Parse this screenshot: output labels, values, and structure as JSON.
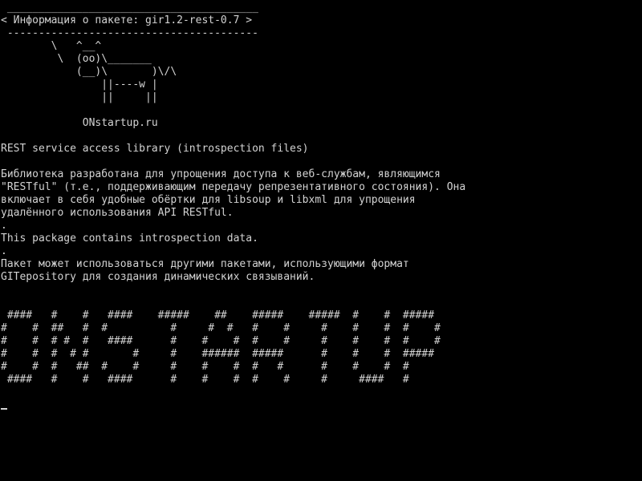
{
  "terminal": {
    "fg_color": "#d3d3d3",
    "bg_color": "#000000",
    "lines": [
      " ________________________________________",
      "< Информация о пакете: gir1.2-rest-0.7 >",
      " ----------------------------------------",
      "        \\   ^__^",
      "         \\  (oo)\\_______",
      "            (__)\\       )\\/\\",
      "                ||----w |",
      "                ||     ||",
      "",
      "             ONstartup.ru",
      "",
      "REST service access library (introspection files)",
      "",
      "Библиотека разработана для упрощения доступа к веб-службам, являющимся",
      "\"RESTful\" (т.е., поддерживающим передачу репрезентативного состояния). Она",
      "включает в себя удобные обёртки для libsoup и libxml для упрощения",
      "удалённого использования API RESTful.",
      ".",
      "This package contains introspection data.",
      ".",
      "Пакет может использоваться другими пакетами, использующими формат",
      "GITepository для создания динамических связываний.",
      "",
      "",
      " ####   #    #   ####    #####    ##    #####    #####  #    #  #####",
      "#    #  ##   #  #          #     #  #   #    #     #    #    #  #    #",
      "#    #  # #  #   ####      #    #    #  #    #     #    #    #  #    #",
      "#    #  #  # #       #     #    ######  #####      #    #    #  #####",
      "#    #  #   ##  #    #     #    #    #  #   #      #    #    #  #",
      " ####   #    #   ####      #    #    #  #    #     #     ####   #",
      ""
    ]
  }
}
